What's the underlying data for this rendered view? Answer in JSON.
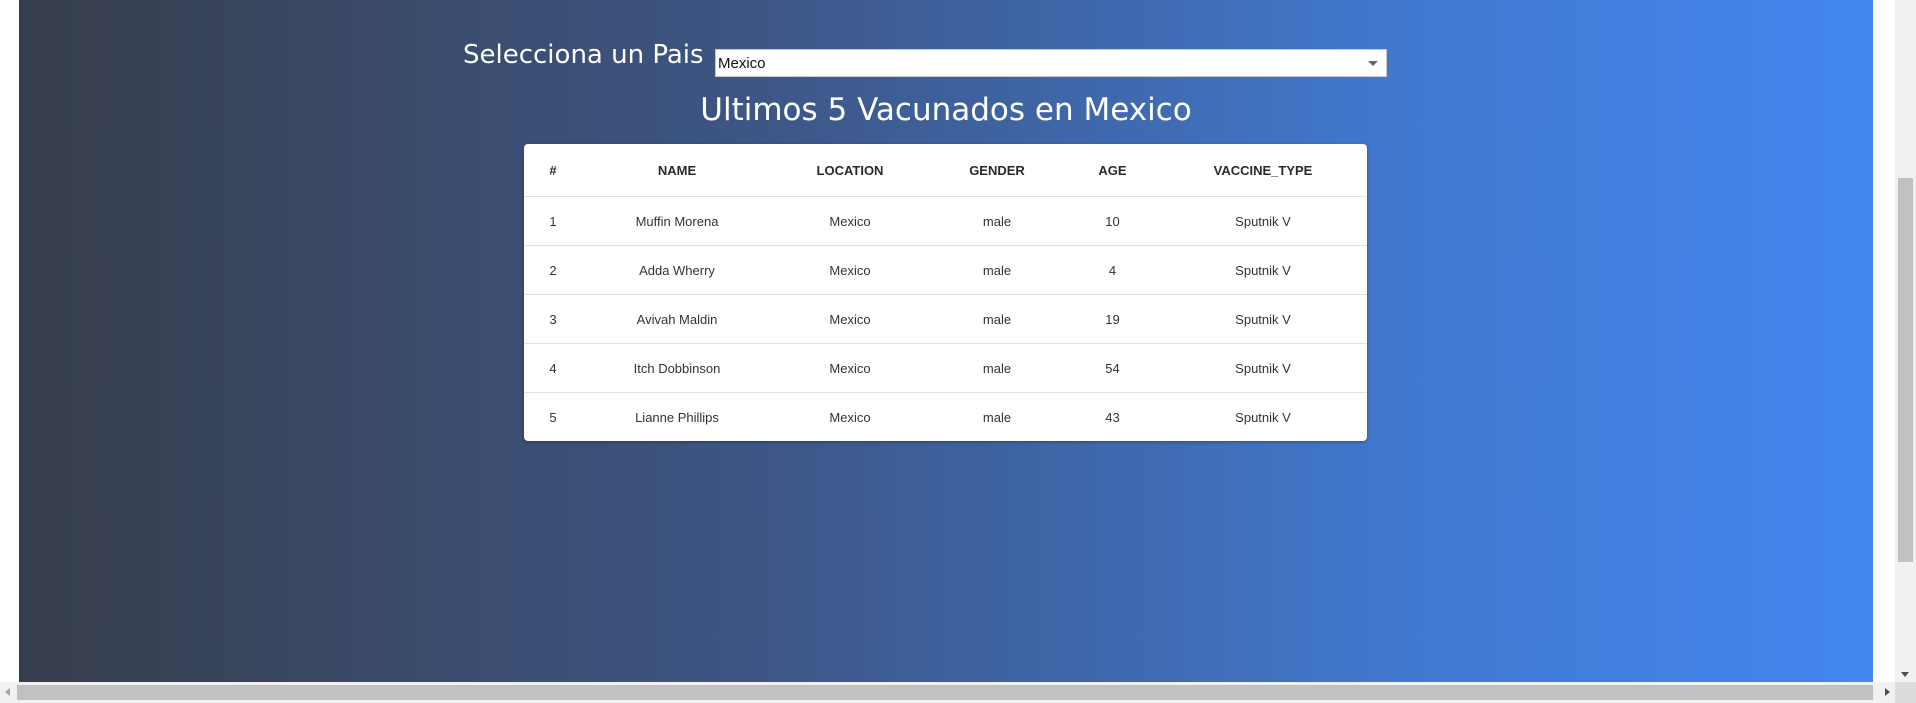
{
  "selector": {
    "label": "Selecciona un Pais",
    "selected": "Mexico"
  },
  "heading": "Ultimos 5 Vacunados en Mexico",
  "table": {
    "headers": [
      "#",
      "NAME",
      "LOCATION",
      "GENDER",
      "AGE",
      "VACCINE_TYPE"
    ],
    "rows": [
      [
        "1",
        "Muffin Morena",
        "Mexico",
        "male",
        "10",
        "Sputnik V"
      ],
      [
        "2",
        "Adda Wherry",
        "Mexico",
        "male",
        "4",
        "Sputnik V"
      ],
      [
        "3",
        "Avivah Maldin",
        "Mexico",
        "male",
        "19",
        "Sputnik V"
      ],
      [
        "4",
        "Itch Dobbinson",
        "Mexico",
        "male",
        "54",
        "Sputnik V"
      ],
      [
        "5",
        "Lianne Phillips",
        "Mexico",
        "male",
        "43",
        "Sputnik V"
      ]
    ]
  },
  "colors": {
    "gradient_start": "#373e4c",
    "gradient_end": "#4286ef"
  },
  "icons": {
    "select_caret": "chevron-down-icon",
    "scroll_down": "arrow-down-icon",
    "scroll_left": "arrow-left-icon",
    "scroll_right": "arrow-right-icon"
  }
}
